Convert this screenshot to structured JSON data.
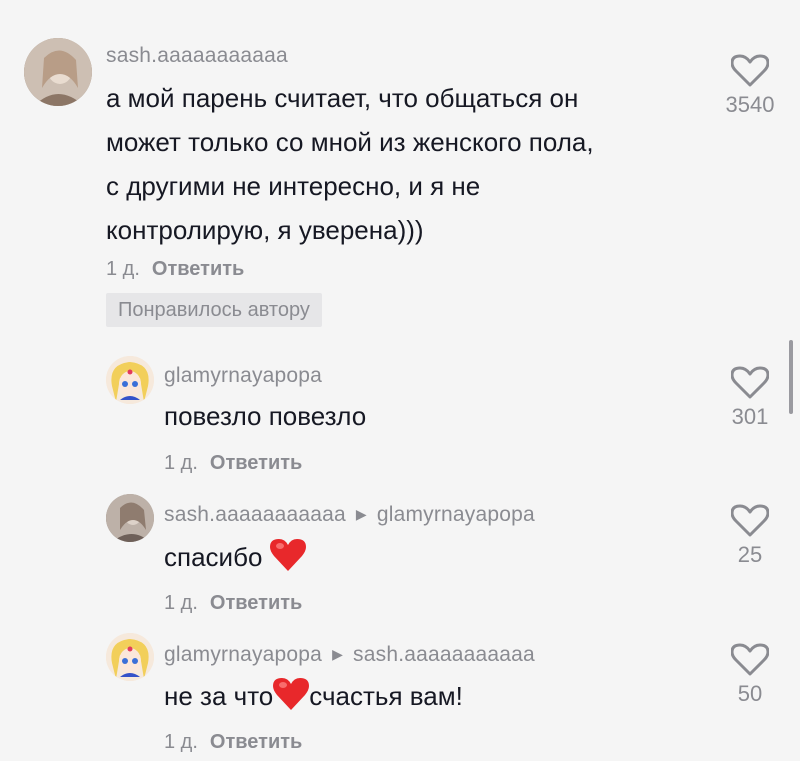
{
  "comments": [
    {
      "user": "sash.aaaaaaaaaaa",
      "text_lines": [
        "а мой парень считает, что общаться он",
        "может только со мной из женского пола,",
        "с другими не интересно, и я не",
        "контролирую, я уверена)))"
      ],
      "time": "1 д.",
      "reply_label": "Ответить",
      "badge": "Понравилось автору",
      "likes": "3540"
    }
  ],
  "replies": [
    {
      "user": "glamyrnayapopa",
      "reply_to": "",
      "text_before": "повезло повезло",
      "text_after": "",
      "emoji": "",
      "time": "1 д.",
      "reply_label": "Ответить",
      "likes": "301"
    },
    {
      "user": "sash.aaaaaaaaaaa",
      "reply_to": "glamyrnayapopa",
      "text_before": "спасибо",
      "text_after": "",
      "emoji": "red-heart",
      "time": "1 д.",
      "reply_label": "Ответить",
      "likes": "25"
    },
    {
      "user": "glamyrnayapopa",
      "reply_to": "sash.aaaaaaaaaaa",
      "text_before": "не за что",
      "text_after": "счастья вам!",
      "emoji": "red-heart",
      "time": "1 д.",
      "reply_label": "Ответить",
      "likes": "50"
    }
  ],
  "colors": {
    "background": "#f5f5f5",
    "text": "#161823",
    "muted": "#8a8b91",
    "heart_emoji": "#e8282b"
  },
  "icons": [
    "heart-outline-icon",
    "reply-arrow-icon",
    "red-heart-emoji"
  ]
}
